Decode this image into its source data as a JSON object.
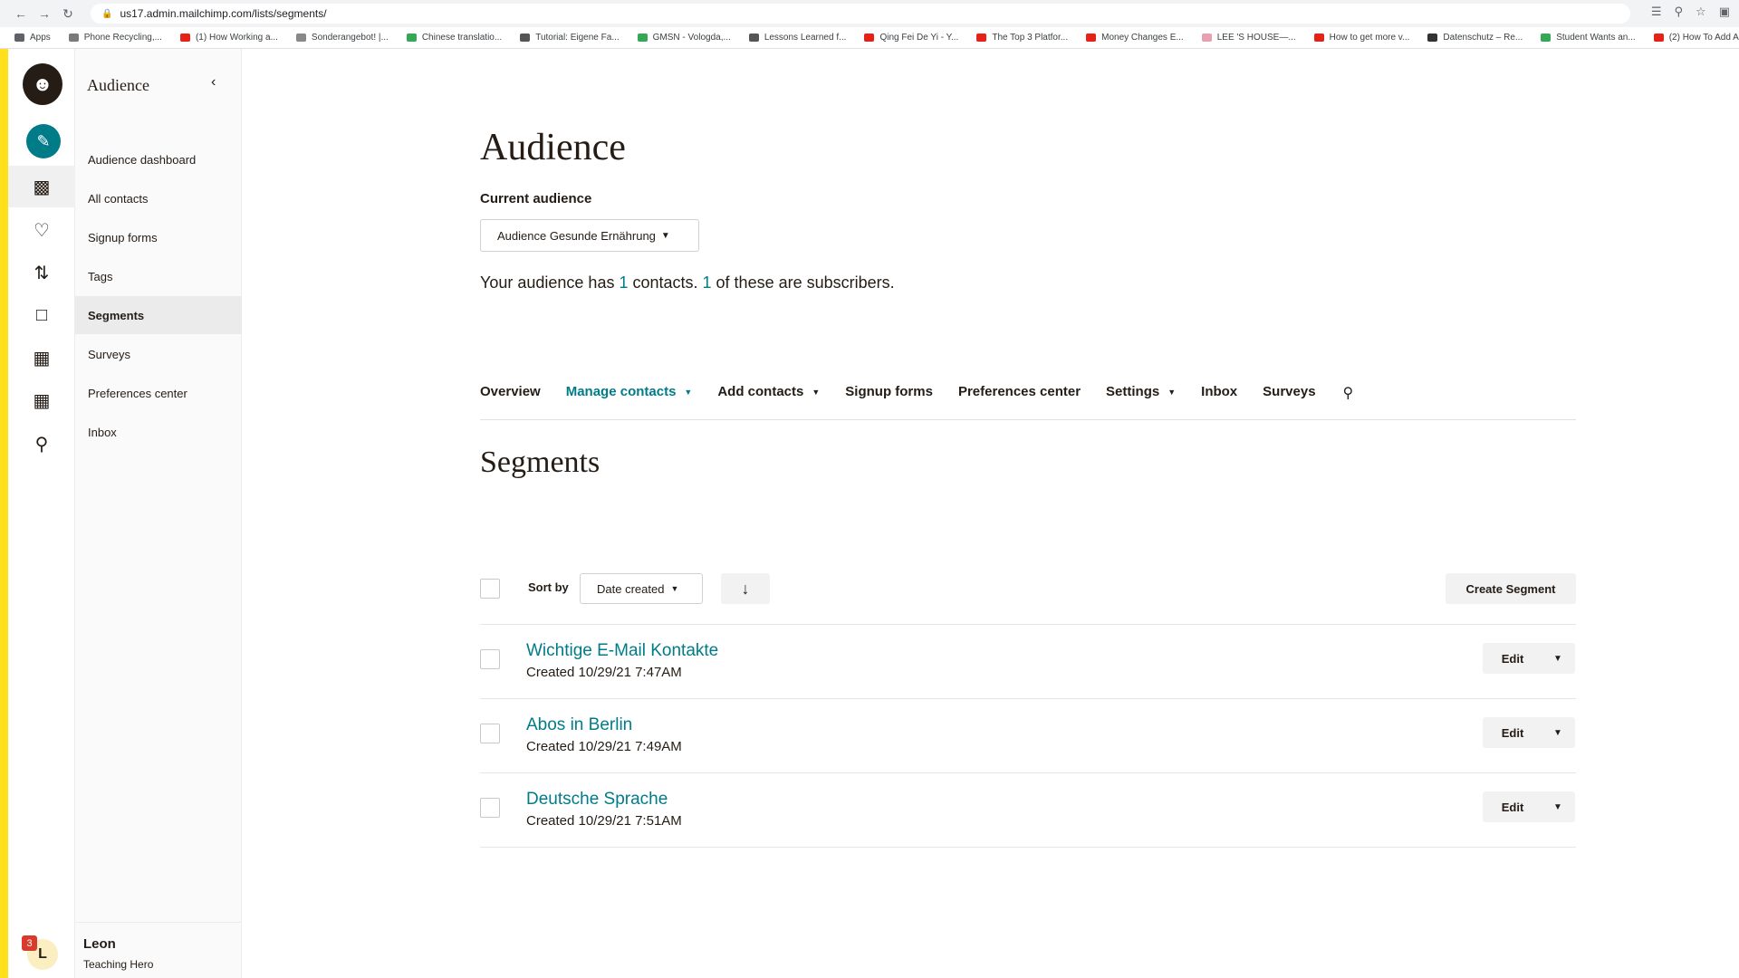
{
  "browser": {
    "url": "us17.admin.mailchimp.com/lists/segments/",
    "bookmarks": [
      {
        "label": "Apps",
        "color": "#5f6368"
      },
      {
        "label": "Phone Recycling,...",
        "color": "#7a7a7a"
      },
      {
        "label": "(1) How Working a...",
        "color": "#e62117"
      },
      {
        "label": "Sonderangebot! |...",
        "color": "#888888"
      },
      {
        "label": "Chinese translatio...",
        "color": "#34a853"
      },
      {
        "label": "Tutorial: Eigene Fa...",
        "color": "#555555"
      },
      {
        "label": "GMSN - Vologda,...",
        "color": "#34a853"
      },
      {
        "label": "Lessons Learned f...",
        "color": "#555555"
      },
      {
        "label": "Qing Fei De Yi - Y...",
        "color": "#e62117"
      },
      {
        "label": "The Top 3 Platfor...",
        "color": "#e62117"
      },
      {
        "label": "Money Changes E...",
        "color": "#e62117"
      },
      {
        "label": "LEE 'S HOUSE—...",
        "color": "#e8a0b0"
      },
      {
        "label": "How to get more v...",
        "color": "#e62117"
      },
      {
        "label": "Datenschutz – Re...",
        "color": "#333333"
      },
      {
        "label": "Student Wants an...",
        "color": "#34a853"
      },
      {
        "label": "(2) How To Add A...",
        "color": "#e62117"
      }
    ]
  },
  "sidebar": {
    "title": "Audience",
    "items": [
      {
        "label": "Audience dashboard"
      },
      {
        "label": "All contacts"
      },
      {
        "label": "Signup forms"
      },
      {
        "label": "Tags"
      },
      {
        "label": "Segments"
      },
      {
        "label": "Surveys"
      },
      {
        "label": "Preferences center"
      },
      {
        "label": "Inbox"
      }
    ],
    "active_index": 4,
    "user": {
      "name": "Leon",
      "role": "Teaching Hero",
      "initial": "L",
      "badge": "3"
    }
  },
  "rail": {
    "logo_icon": "mailchimp-logo-icon",
    "icons": [
      "create-icon",
      "audience-icon",
      "campaigns-icon",
      "automations-icon",
      "website-icon",
      "content-icon",
      "integrations-icon",
      "search-icon"
    ]
  },
  "main": {
    "title": "Audience",
    "current_audience_label": "Current audience",
    "audience_selected": "Audience Gesunde Ernährung",
    "summary": {
      "prefix": "Your audience has ",
      "contacts": "1",
      "middle": " contacts. ",
      "subscribers": "1",
      "suffix": " of these are subscribers."
    },
    "tabs": [
      {
        "label": "Overview"
      },
      {
        "label": "Manage contacts"
      },
      {
        "label": "Add contacts"
      },
      {
        "label": "Signup forms"
      },
      {
        "label": "Preferences center"
      },
      {
        "label": "Settings"
      },
      {
        "label": "Inbox"
      },
      {
        "label": "Surveys"
      }
    ],
    "segments_title": "Segments",
    "sort_label": "Sort by",
    "sort_value": "Date created",
    "sort_direction_icon": "arrow-down-icon",
    "create_button": "Create Segment",
    "segments": [
      {
        "name": "Wichtige E-Mail Kontakte",
        "created": "Created 10/29/21 7:47AM",
        "action": "Edit"
      },
      {
        "name": "Abos in Berlin",
        "created": "Created 10/29/21 7:49AM",
        "action": "Edit"
      },
      {
        "name": "Deutsche Sprache",
        "created": "Created 10/29/21 7:51AM",
        "action": "Edit"
      }
    ]
  },
  "colors": {
    "accent": "#007c89",
    "brand_yellow": "#ffe01b",
    "text": "#241c15"
  }
}
